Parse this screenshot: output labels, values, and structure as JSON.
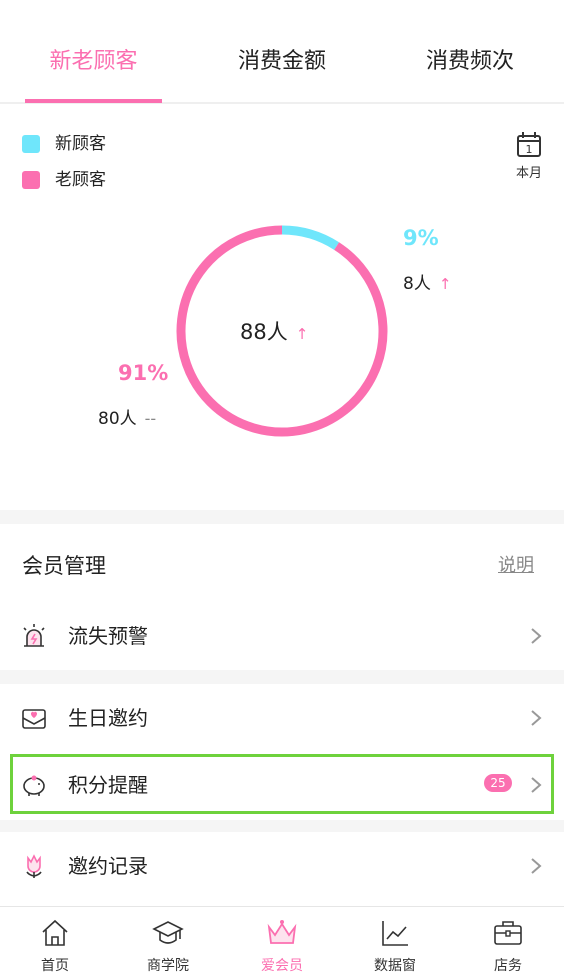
{
  "tabs": [
    {
      "label": "新老顾客",
      "active": true
    },
    {
      "label": "消费金额",
      "active": false
    },
    {
      "label": "消费频次",
      "active": false
    }
  ],
  "legend": [
    {
      "label": "新顾客",
      "color": "#6fe6fb"
    },
    {
      "label": "老顾客",
      "color": "#fb6fb0"
    }
  ],
  "month_button": {
    "label": "本月",
    "day": "1",
    "icon": "calendar-icon"
  },
  "chart_data": {
    "type": "pie",
    "categories": [
      "新顾客",
      "老顾客"
    ],
    "values": [
      8,
      80
    ],
    "percent_labels": [
      "9%",
      "91%"
    ],
    "count_labels": [
      "8人",
      "80人"
    ],
    "trend": [
      "up",
      "flat"
    ],
    "flat_mark": "--",
    "total_label": "88人",
    "total_trend": "up",
    "colors": [
      "#6fe6fb",
      "#fb6fb0"
    ]
  },
  "section": {
    "title": "会员管理",
    "explain": "说明"
  },
  "rows": [
    {
      "label": "流失预警",
      "icon": "alarm-light-icon"
    },
    {
      "label": "生日邀约",
      "icon": "heart-envelope-icon"
    },
    {
      "label": "积分提醒",
      "icon": "piggy-bank-icon",
      "badge": "25"
    },
    {
      "label": "邀约记录",
      "icon": "flower-icon"
    }
  ],
  "nav": [
    {
      "label": "首页",
      "icon": "home-icon",
      "active": false
    },
    {
      "label": "商学院",
      "icon": "graduation-cap-icon",
      "active": false
    },
    {
      "label": "爱会员",
      "icon": "crown-icon",
      "active": true
    },
    {
      "label": "数据窗",
      "icon": "chart-icon",
      "active": false
    },
    {
      "label": "店务",
      "icon": "briefcase-icon",
      "active": false
    }
  ]
}
